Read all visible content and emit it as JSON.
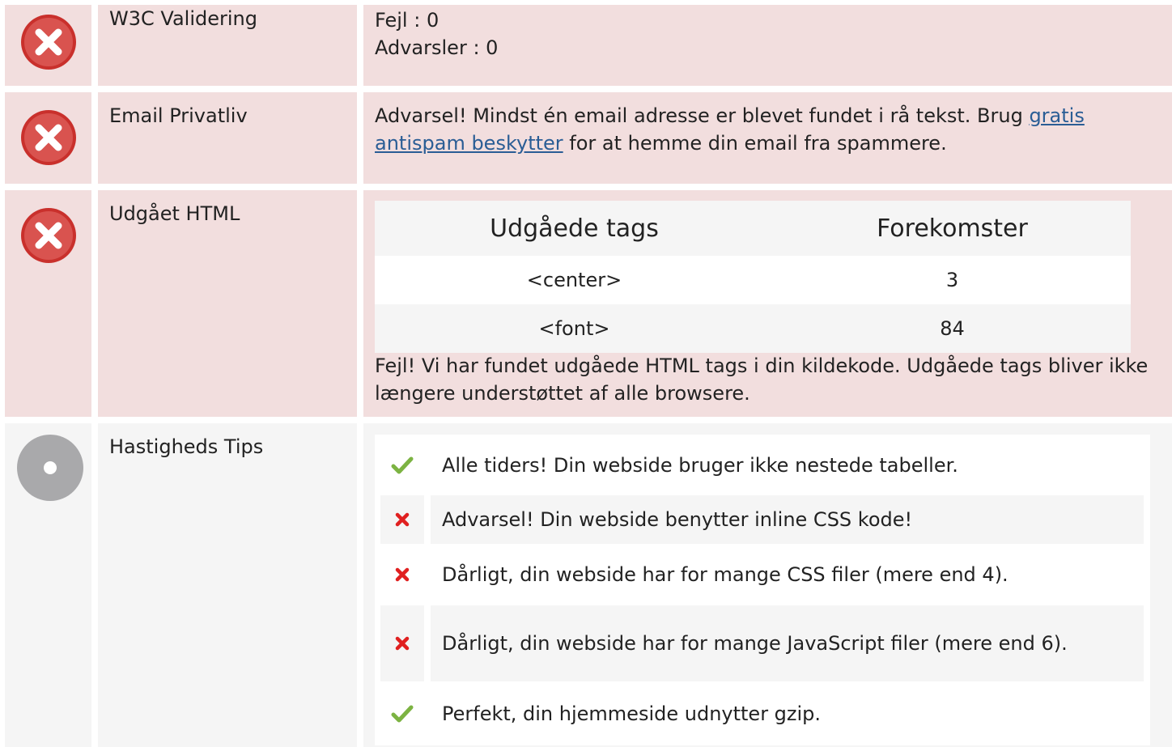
{
  "rows": {
    "w3c": {
      "label": "W3C Validering",
      "errors": "Fejl : 0",
      "warnings": "Advarsler : 0"
    },
    "email": {
      "label": "Email Privatliv",
      "text_before": "Advarsel! Mindst én email adresse er blevet fundet i rå tekst. Brug ",
      "link": "gratis antispam beskytter",
      "text_after": " for at hemme din email fra spammere."
    },
    "deprecated": {
      "label": "Udgået HTML",
      "headers": [
        "Udgåede tags",
        "Forekomster"
      ],
      "rows": [
        {
          "tag": "<center>",
          "count": "3"
        },
        {
          "tag": "<font>",
          "count": "84"
        }
      ],
      "note": "Fejl! Vi har fundet udgåede HTML tags i din kildekode. Udgåede tags bliver ikke længere understøttet af alle browsere."
    },
    "speed": {
      "label": "Hastigheds Tips",
      "tips": [
        {
          "status": "ok",
          "text": "Alle tiders! Din webside bruger ikke nestede tabeller."
        },
        {
          "status": "bad",
          "text": "Advarsel! Din webside benytter inline CSS kode!"
        },
        {
          "status": "bad",
          "text": "Dårligt, din webside har for mange CSS filer (mere end 4)."
        },
        {
          "status": "bad",
          "text": "Dårligt, din webside har for mange JavaScript filer (mere end 6)."
        },
        {
          "status": "ok",
          "text": "Perfekt, din hjemmeside udnytter gzip."
        }
      ]
    }
  },
  "colors": {
    "error_bg": "#f2dede",
    "neutral_bg": "#f5f5f5",
    "error_icon": "#d9534f",
    "ok_check": "#7cb342",
    "bad_cross": "#e02020",
    "link": "#2a5d95"
  }
}
